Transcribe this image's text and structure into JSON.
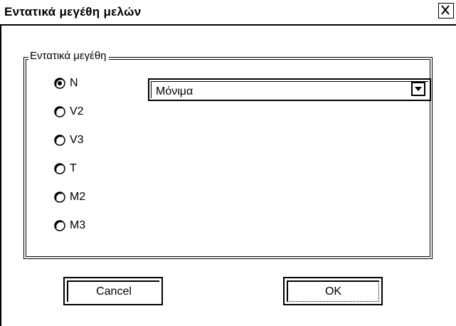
{
  "window": {
    "title": "Εντατικά μεγέθη μελών",
    "close_icon": "close-icon"
  },
  "group": {
    "title": "Εντατικά μεγέθη",
    "radios": [
      {
        "label": "N",
        "selected": true
      },
      {
        "label": "V2",
        "selected": false
      },
      {
        "label": "V3",
        "selected": false
      },
      {
        "label": "T",
        "selected": false
      },
      {
        "label": "M2",
        "selected": false
      },
      {
        "label": "M3",
        "selected": false
      }
    ],
    "combo": {
      "value": "Μόνιμα",
      "arrow_icon": "chevron-down-icon"
    }
  },
  "buttons": {
    "cancel_label": "Cancel",
    "ok_label": "OK"
  }
}
